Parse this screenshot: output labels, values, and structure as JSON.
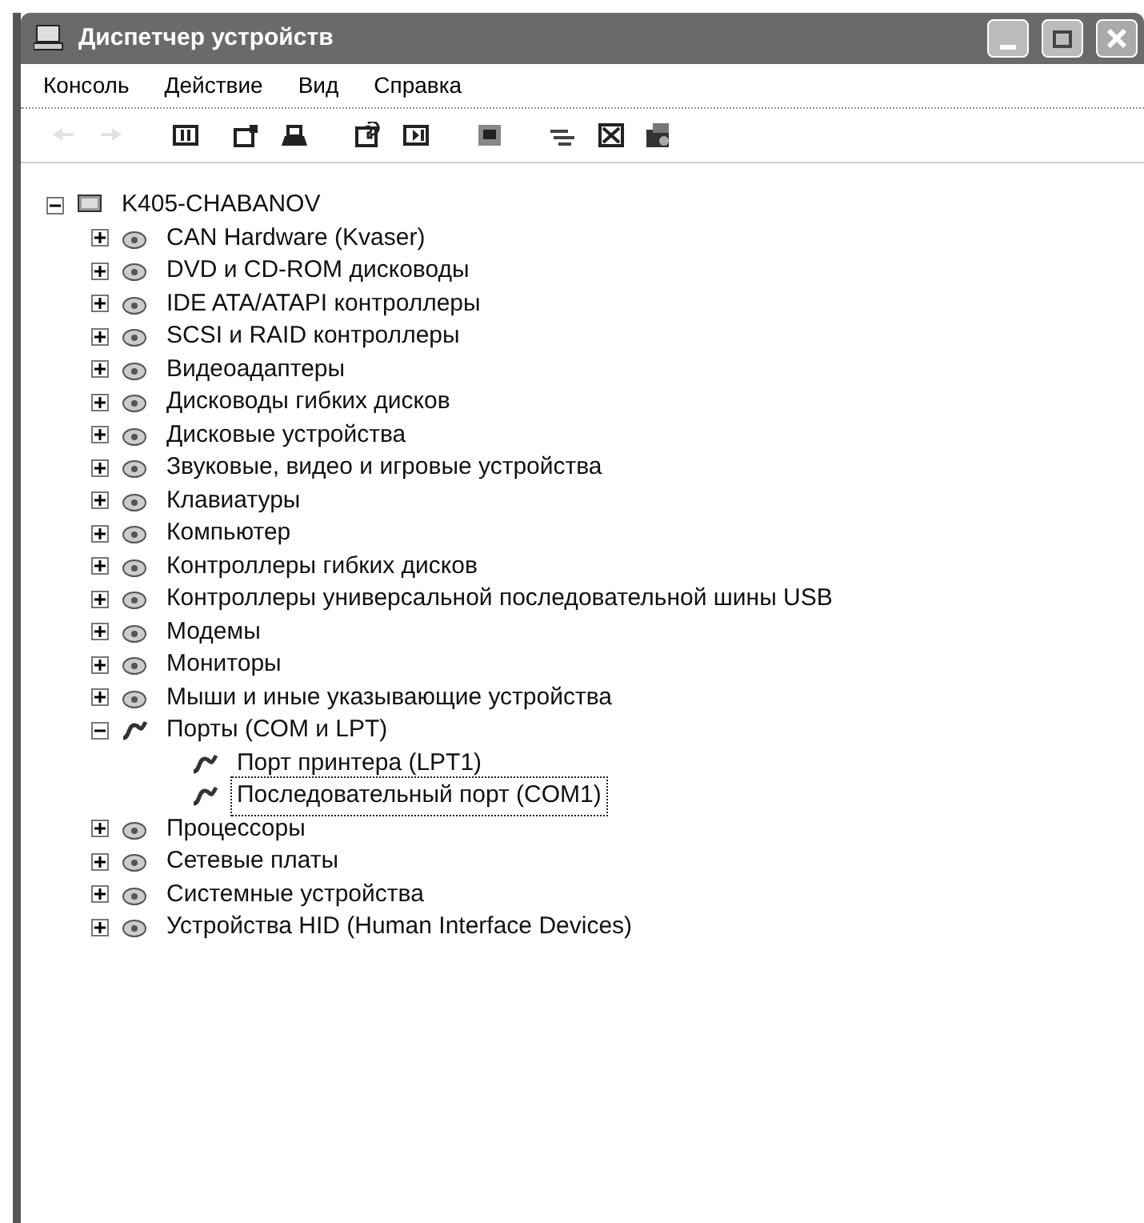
{
  "window": {
    "title": "Диспетчер устройств"
  },
  "menu": [
    "Консоль",
    "Действие",
    "Вид",
    "Справка"
  ],
  "toolbar": [
    {
      "disabled": true
    },
    {
      "disabled": true
    },
    {
      "disabled": false
    },
    {
      "disabled": false
    },
    {
      "disabled": false
    },
    {
      "disabled": false
    },
    {
      "disabled": false
    },
    {
      "disabled": false
    },
    {
      "disabled": false
    },
    {
      "disabled": false
    },
    {
      "disabled": false
    }
  ],
  "tree": {
    "label": "K405-CHABANOV",
    "expanded": true,
    "children": [
      {
        "label": "CAN Hardware (Kvaser)",
        "expanded": false
      },
      {
        "label": "DVD и CD-ROM дисководы",
        "expanded": false
      },
      {
        "label": "IDE ATA/ATAPI контроллеры",
        "expanded": false
      },
      {
        "label": "SCSI и RAID контроллеры",
        "expanded": false
      },
      {
        "label": "Видеоадаптеры",
        "expanded": false
      },
      {
        "label": "Дисководы гибких дисков",
        "expanded": false
      },
      {
        "label": "Дисковые устройства",
        "expanded": false
      },
      {
        "label": "Звуковые, видео и игровые устройства",
        "expanded": false
      },
      {
        "label": "Клавиатуры",
        "expanded": false
      },
      {
        "label": "Компьютер",
        "expanded": false
      },
      {
        "label": "Контроллеры гибких дисков",
        "expanded": false
      },
      {
        "label": "Контроллеры универсальной последовательной шины USB",
        "expanded": false
      },
      {
        "label": "Модемы",
        "expanded": false
      },
      {
        "label": "Мониторы",
        "expanded": false
      },
      {
        "label": "Мыши и иные указывающие устройства",
        "expanded": false
      },
      {
        "label": "Порты (COM и LPT)",
        "expanded": true,
        "children": [
          {
            "label": "Порт принтера (LPT1)",
            "selected": false
          },
          {
            "label": "Последовательный порт (COM1)",
            "selected": true
          }
        ]
      },
      {
        "label": "Процессоры",
        "expanded": false
      },
      {
        "label": "Сетевые платы",
        "expanded": false
      },
      {
        "label": "Системные устройства",
        "expanded": false
      },
      {
        "label": "Устройства HID (Human Interface Devices)",
        "expanded": false
      }
    ]
  }
}
